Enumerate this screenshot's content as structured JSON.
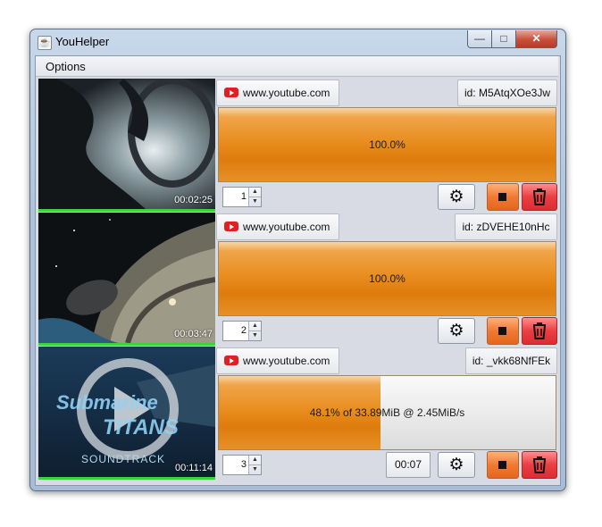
{
  "window": {
    "title": "YouHelper",
    "controls": {
      "minimize": "—",
      "maximize": "□",
      "close": "✕"
    }
  },
  "menu": {
    "items": [
      "Options"
    ]
  },
  "colors": {
    "progress": "#e98e20",
    "green_indicator": "#37d63a",
    "stop": "#f07a32",
    "delete": "#ea3e42"
  },
  "downloads": [
    {
      "source": "www.youtube.com",
      "id_label": "id: M5AtqXOe3Jw",
      "duration": "00:02:25",
      "progress": 1.0,
      "progress_text": "100.0%",
      "index": "1",
      "icons": [
        "youtube-icon",
        "gear-icon",
        "stop-icon",
        "trash-icon"
      ]
    },
    {
      "source": "www.youtube.com",
      "id_label": "id: zDVEHE10nHc",
      "duration": "00:03:47",
      "progress": 1.0,
      "progress_text": "100.0%",
      "index": "2",
      "icons": [
        "youtube-icon",
        "gear-icon",
        "stop-icon",
        "trash-icon"
      ]
    },
    {
      "source": "www.youtube.com",
      "id_label": "id: _vkk68NfFEk",
      "duration": "00:11:14",
      "progress": 0.481,
      "progress_text": "48.1% of 33.89MiB @ 2.45MiB/s",
      "index": "3",
      "eta": "00:07",
      "thumb_text": [
        "Submarine",
        "TITANS",
        "SOUNDTRACK"
      ],
      "icons": [
        "youtube-icon",
        "gear-icon",
        "stop-icon",
        "trash-icon"
      ]
    }
  ]
}
